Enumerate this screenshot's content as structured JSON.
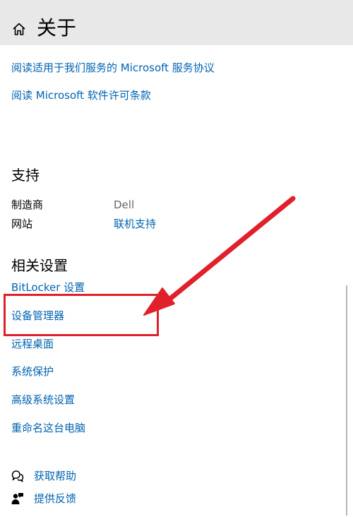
{
  "header": {
    "home_icon": "home-icon",
    "title": "关于"
  },
  "agreement_links": [
    "阅读适用于我们服务的 Microsoft 服务协议",
    "阅读 Microsoft 软件许可条款"
  ],
  "support": {
    "title": "支持",
    "manufacturer_label": "制造商",
    "manufacturer_value": "Dell",
    "website_label": "网站",
    "website_value": "联机支持"
  },
  "related_settings": {
    "title": "相关设置",
    "links": [
      "BitLocker 设置",
      "设备管理器",
      "远程桌面",
      "系统保护",
      "高级系统设置",
      "重命名这台电脑"
    ]
  },
  "footer": {
    "help_icon": "chat-bubbles-icon",
    "help_label": "获取帮助",
    "feedback_icon": "feedback-person-icon",
    "feedback_label": "提供反馈"
  },
  "annotation": {
    "color": "#e0202a",
    "highlight_target": "设备管理器"
  },
  "colors": {
    "link": "#0063b1",
    "header_bg": "#e8e8e8",
    "text": "#000000",
    "muted": "#666666"
  }
}
